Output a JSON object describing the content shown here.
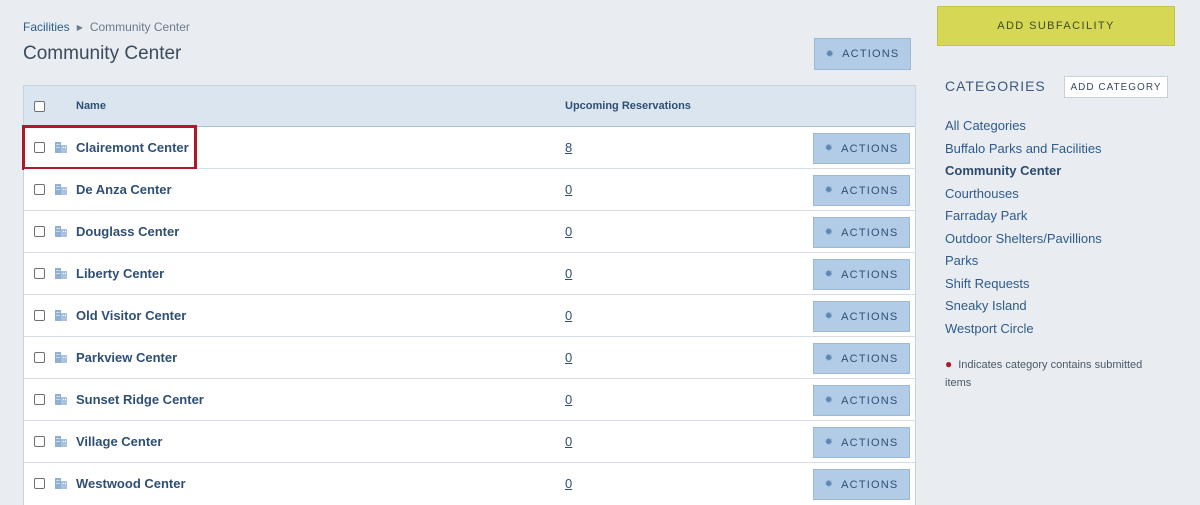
{
  "breadcrumb": {
    "root": "Facilities",
    "current": "Community Center"
  },
  "page_title": "Community Center",
  "header_actions_label": "ACTIONS",
  "table": {
    "columns": {
      "name": "Name",
      "reservations": "Upcoming Reservations"
    },
    "rows": [
      {
        "name": "Clairemont Center",
        "reservations": "8",
        "actions": "ACTIONS"
      },
      {
        "name": "De Anza Center",
        "reservations": "0",
        "actions": "ACTIONS"
      },
      {
        "name": "Douglass Center",
        "reservations": "0",
        "actions": "ACTIONS"
      },
      {
        "name": "Liberty Center",
        "reservations": "0",
        "actions": "ACTIONS"
      },
      {
        "name": "Old Visitor Center",
        "reservations": "0",
        "actions": "ACTIONS"
      },
      {
        "name": "Parkview Center",
        "reservations": "0",
        "actions": "ACTIONS"
      },
      {
        "name": "Sunset Ridge Center",
        "reservations": "0",
        "actions": "ACTIONS"
      },
      {
        "name": "Village Center",
        "reservations": "0",
        "actions": "ACTIONS"
      },
      {
        "name": "Westwood Center",
        "reservations": "0",
        "actions": "ACTIONS"
      }
    ]
  },
  "sidebar": {
    "add_subfacility": "ADD SUBFACILITY",
    "categories_heading": "CATEGORIES",
    "add_category": "ADD CATEGORY",
    "categories": [
      "All Categories",
      "Buffalo Parks and Facilities",
      "Community Center",
      "Courthouses",
      "Farraday Park",
      "Outdoor Shelters/Pavillions",
      "Parks",
      "Shift Requests",
      "Sneaky Island",
      "Westport Circle"
    ],
    "active_category": "Community Center",
    "legend_text": "Indicates category contains submitted items"
  },
  "colors": {
    "accent_button": "#b2cce7",
    "add_subfacility": "#d6d755",
    "highlight": "#b0172a"
  }
}
